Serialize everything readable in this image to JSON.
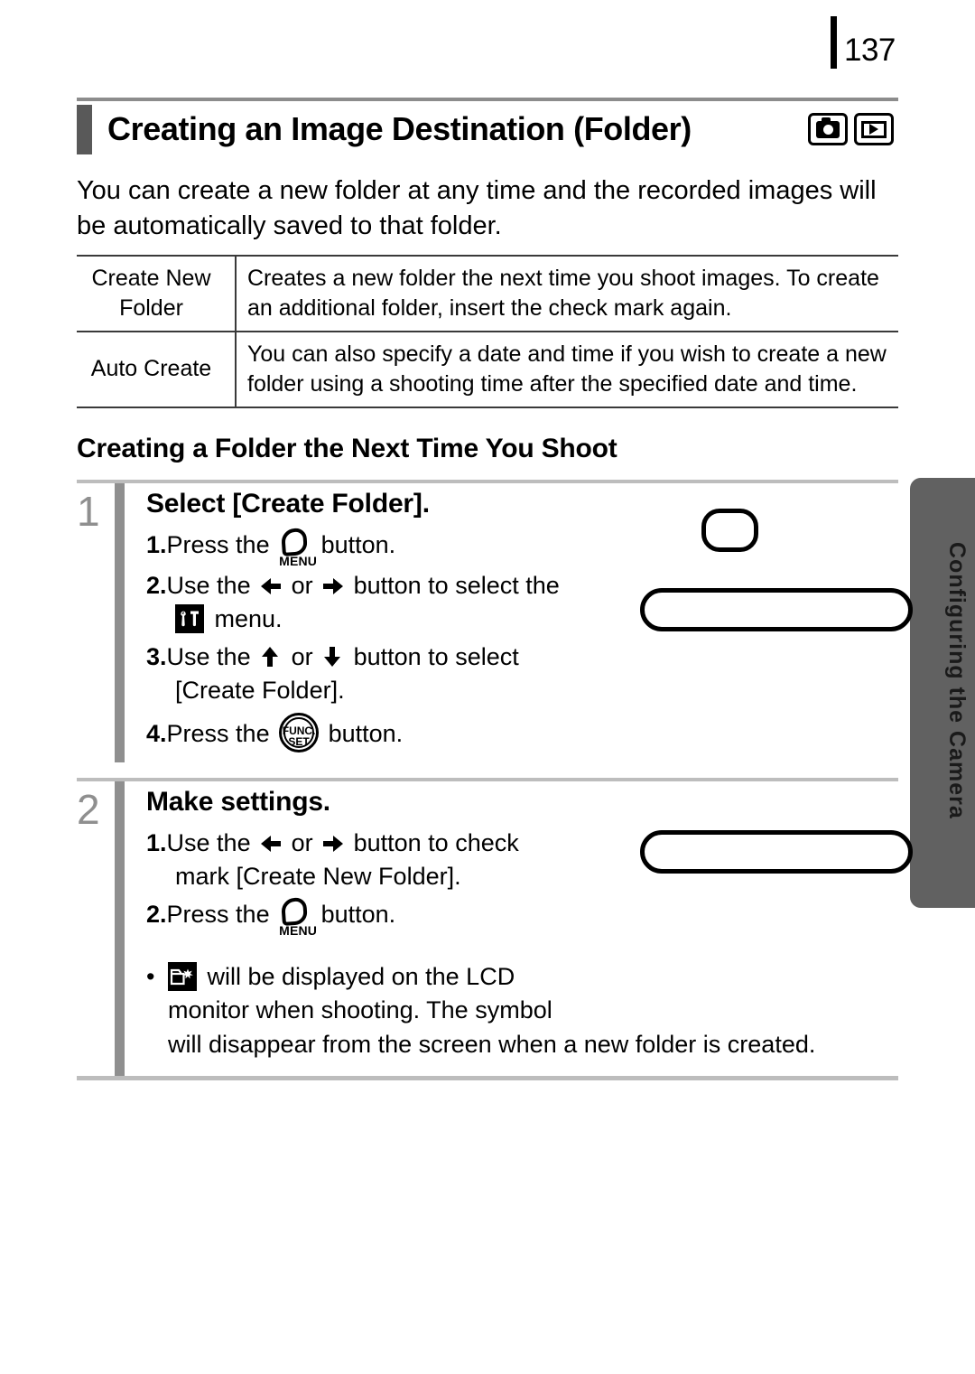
{
  "page": {
    "number": "137",
    "side_tab_label": "Configuring the Camera"
  },
  "header": {
    "title": "Creating an Image Destination (Folder)",
    "mode_icons": [
      {
        "name": "shooting-mode-icon",
        "label": "camera-icon"
      },
      {
        "name": "playback-mode-icon",
        "label": "playback-icon"
      }
    ]
  },
  "intro": "You can create a new folder at any time and the recorded images will be automatically saved to that folder.",
  "spec_table": {
    "rows": [
      {
        "label": "Create New Folder",
        "description": "Creates a new folder the next time you shoot images. To create an additional folder, insert the check mark again."
      },
      {
        "label": "Auto Create",
        "description": "You can also specify a date and time if you wish to create a new folder using a shooting time after the specified date and time."
      }
    ]
  },
  "sub_heading": "Creating a Folder the Next Time You Shoot",
  "steps": [
    {
      "number": "1",
      "title": "Select [Create Folder].",
      "substeps": [
        {
          "num": "1.",
          "pre": "Press the ",
          "icon": "menu-button-icon",
          "post": " button."
        },
        {
          "num": "2.",
          "pre": "Use the ",
          "icon": "left-right-arrows",
          "post": " button to select the ",
          "second_icon": "setup-menu-icon",
          "tail": " menu."
        },
        {
          "num": "3.",
          "pre": "Use the ",
          "icon": "up-down-arrows",
          "post": " button to select",
          "tail": "[Create Folder]."
        },
        {
          "num": "4.",
          "pre": "Press the ",
          "icon": "func-set-button-icon",
          "post": " button."
        }
      ]
    },
    {
      "number": "2",
      "title": "Make settings.",
      "substeps": [
        {
          "num": "1.",
          "pre": "Use the ",
          "icon": "left-right-arrows",
          "post": " button to check",
          "tail": "mark [Create New Folder]."
        },
        {
          "num": "2.",
          "pre": "Press the ",
          "icon": "menu-button-icon",
          "post": " button."
        }
      ]
    }
  ],
  "note": {
    "bullet": "•",
    "icon": "create-folder-symbol-icon",
    "line1": " will be displayed on the LCD",
    "line2": "monitor when shooting. The symbol",
    "line3": "will disappear from the screen when a new folder is created."
  },
  "inline_labels": {
    "menu": "MENU",
    "func": "FUNC.",
    "set": "SET",
    "or": " or "
  },
  "colors": {
    "title_bar": "#595959",
    "step_gutter": "#8f8f8f",
    "side_tab": "#616161",
    "rule_light": "#bdbdbd",
    "rule_dark": "#8c8c8c"
  }
}
